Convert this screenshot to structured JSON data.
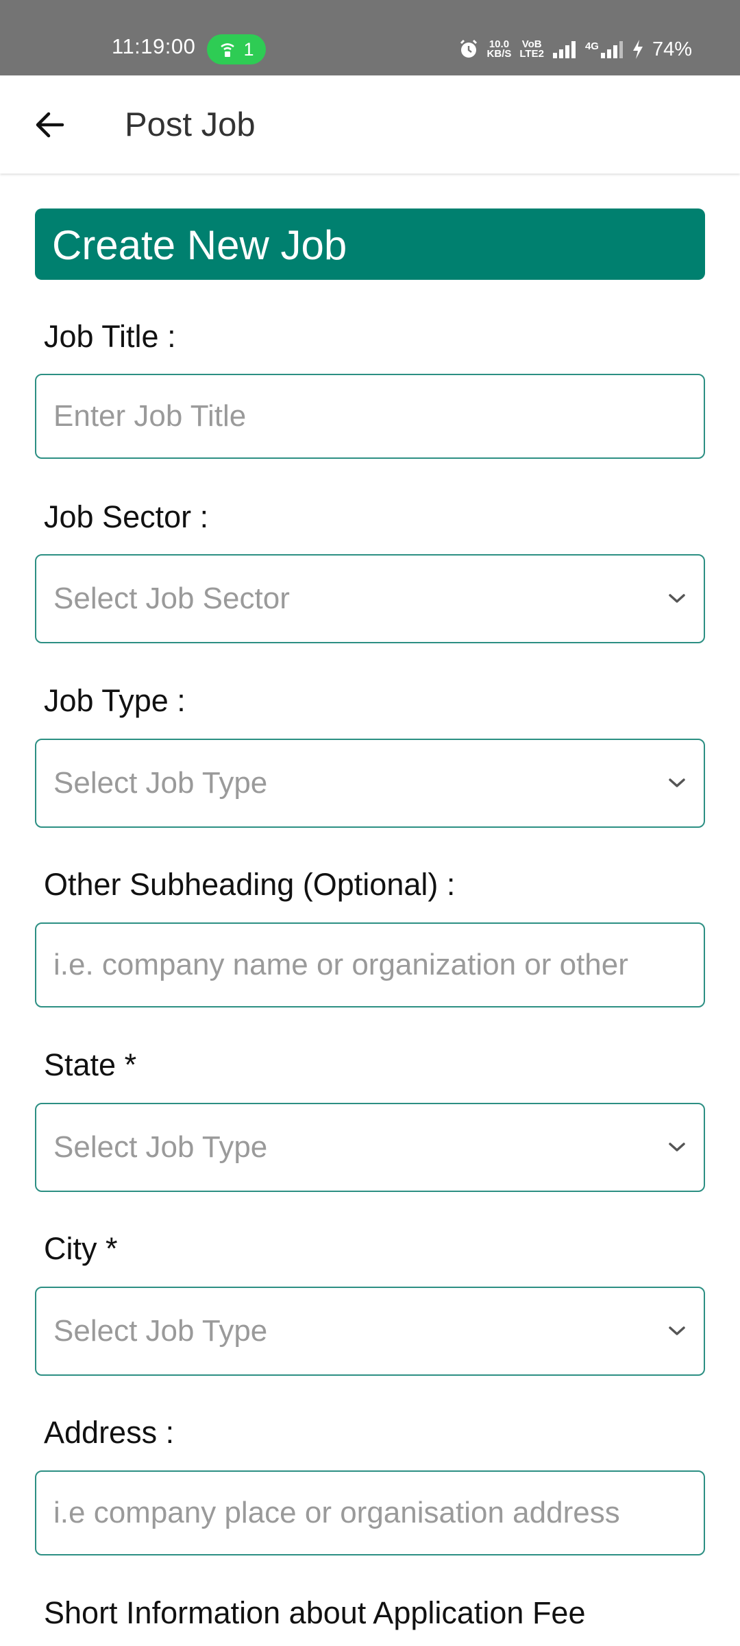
{
  "status_bar": {
    "time": "11:19:00",
    "hotspot_count": "1",
    "net_speed_top": "10.0",
    "net_speed_bottom": "KB/S",
    "volte_top": "VoB",
    "volte_bottom": "LTE2",
    "network_type": "4G",
    "battery": "74%"
  },
  "app_bar": {
    "title": "Post Job"
  },
  "banner": {
    "title": "Create New Job"
  },
  "fields": {
    "job_title": {
      "label": "Job Title :",
      "placeholder": "Enter Job Title"
    },
    "job_sector": {
      "label": "Job Sector :",
      "placeholder": "Select Job Sector"
    },
    "job_type": {
      "label": "Job Type :",
      "placeholder": "Select Job Type"
    },
    "other_subheading": {
      "label": "Other Subheading (Optional) :",
      "placeholder": "i.e. company name or organization or other"
    },
    "state": {
      "label": "State *",
      "placeholder": "Select Job Type"
    },
    "city": {
      "label": "City *",
      "placeholder": "Select Job Type"
    },
    "address": {
      "label": "Address :",
      "placeholder": "i.e company place or organisation address"
    },
    "application_fee": {
      "label": "Short Information about Application Fee"
    }
  },
  "colors": {
    "accent": "#00806f",
    "border": "#2c8f83",
    "status_bar": "#747474",
    "hotspot": "#2ecc54"
  }
}
